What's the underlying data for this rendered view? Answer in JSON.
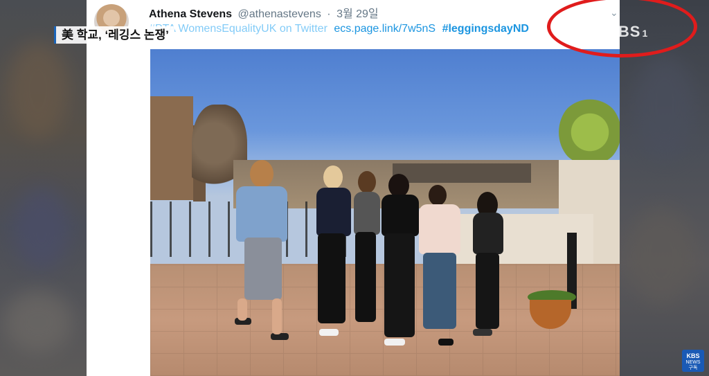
{
  "tweet": {
    "author_name": "Athena Stevens",
    "author_handle": "@athenastevens",
    "date_separator": "·",
    "date": "3월 29일",
    "line_faded_text": "#PTA WomensEqualityUK on Twitter",
    "link_text": "ecs.page.link/7w5nS",
    "hashtag": "#leggingsdayND",
    "caret_icon": "chevron-down-icon"
  },
  "news_overlay": {
    "caption": "美 학교, ‘레깅스 논쟁’",
    "broadcast_logo": "KBS",
    "broadcast_logo_suffix": "1",
    "subscribe_badge_line1": "KBS",
    "subscribe_badge_line2": "NEWS",
    "subscribe_badge_line3": "구독"
  },
  "colors": {
    "highlight_ring": "#e01c1c",
    "link_blue": "#1b95e0",
    "caption_accent": "#1a64b8"
  }
}
